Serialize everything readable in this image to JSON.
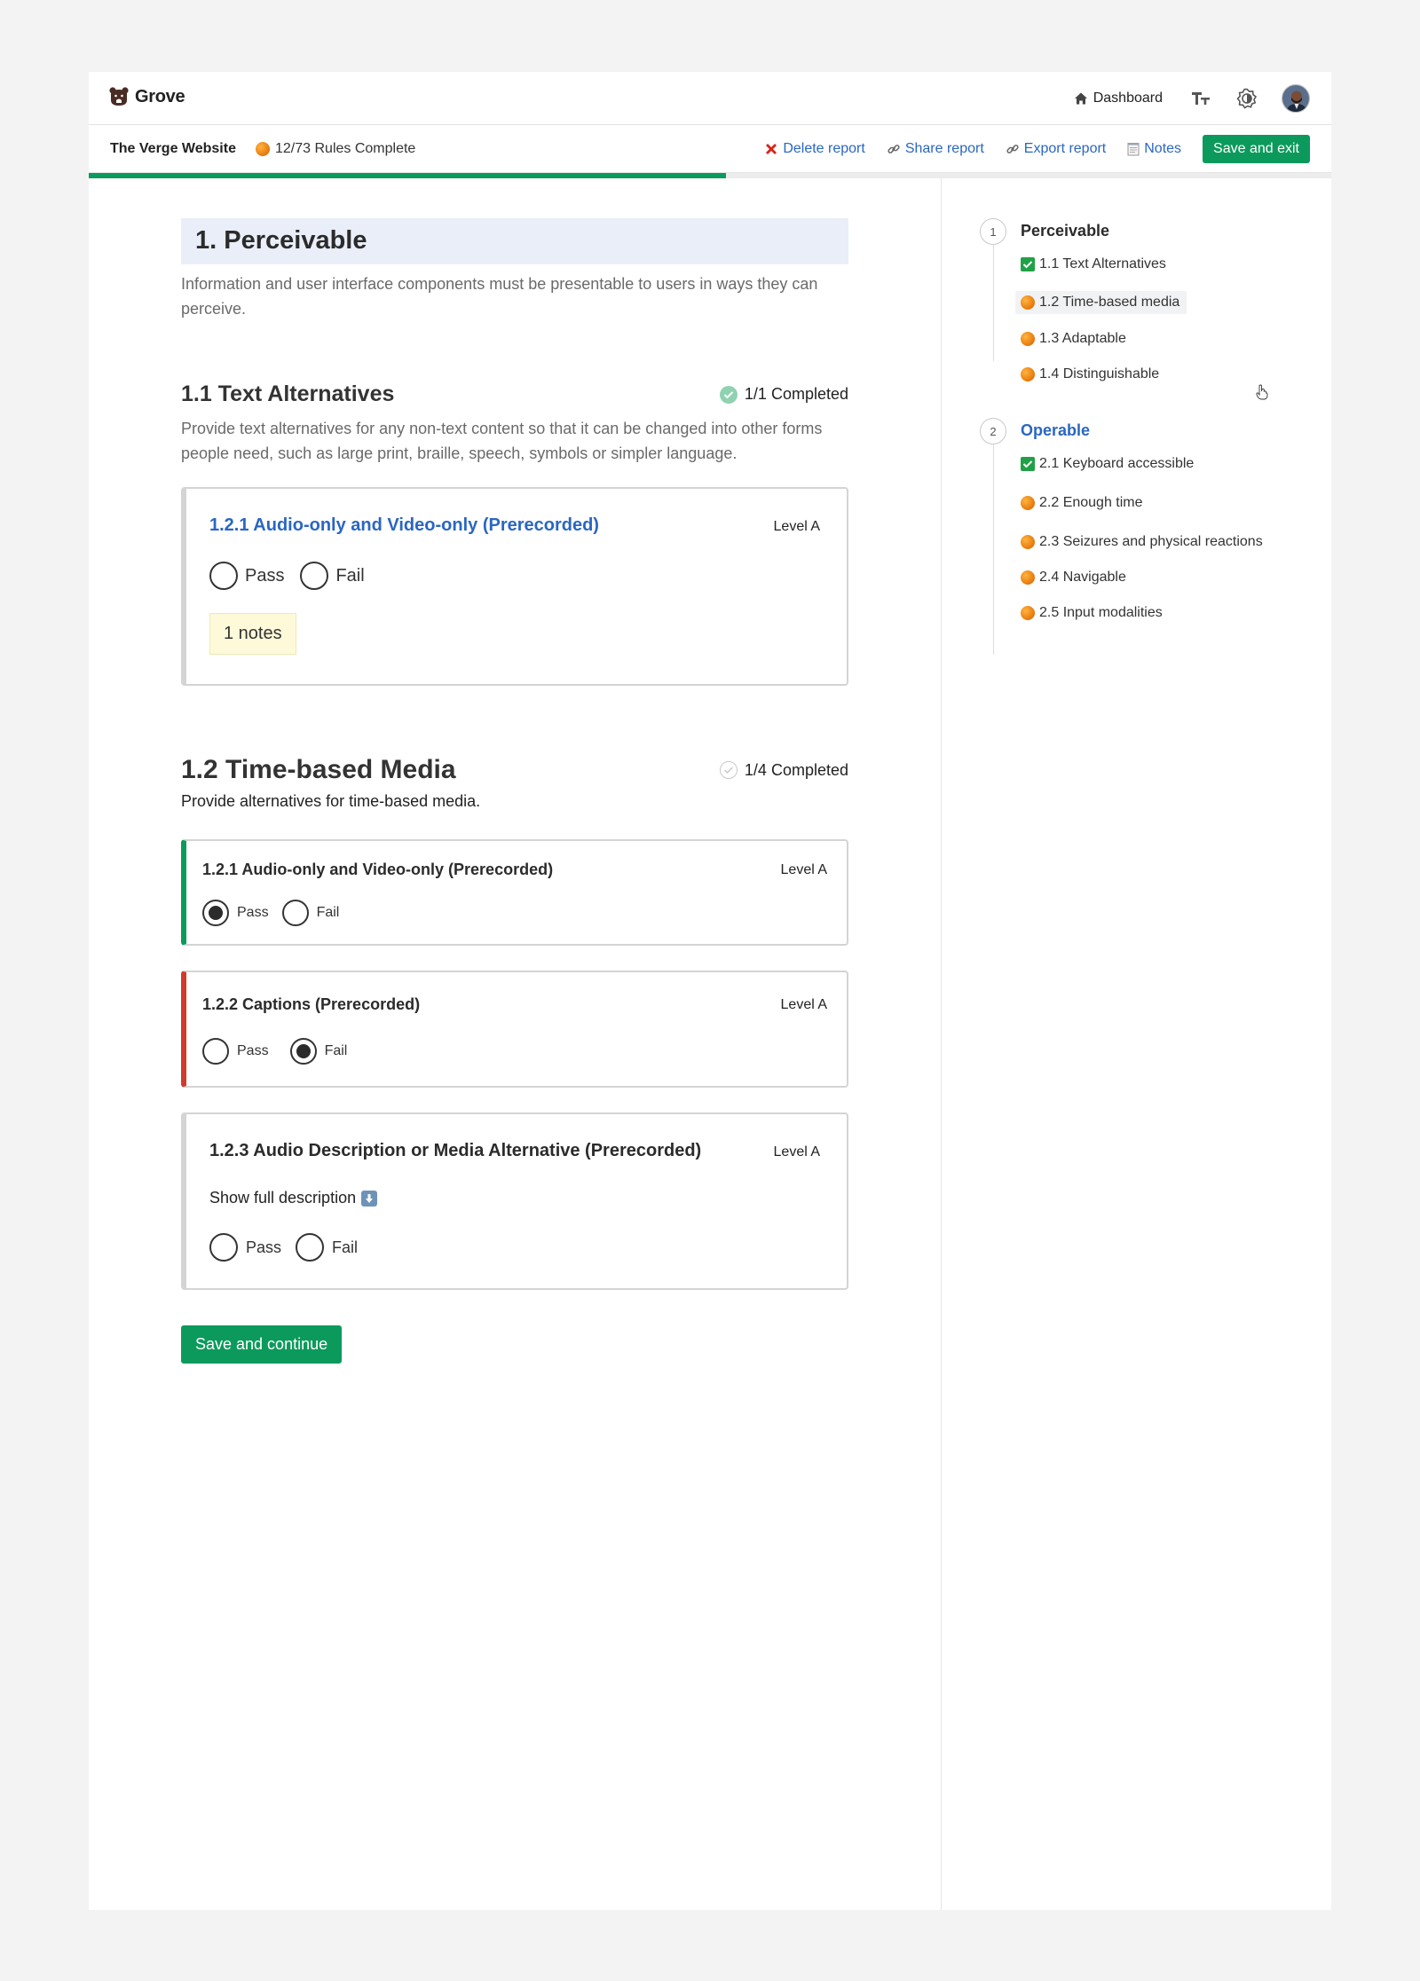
{
  "app": {
    "name": "Grove"
  },
  "header": {
    "dashboard_label": "Dashboard",
    "icons": [
      "text-size-icon",
      "theme-icon",
      "avatar"
    ]
  },
  "report": {
    "title": "The Verge Website",
    "rules_status": "12/73 Rules Complete",
    "progress": 0.513,
    "actions": {
      "delete": "Delete report",
      "share": "Share report",
      "export": "Export report",
      "notes": "Notes",
      "save_exit": "Save and exit"
    }
  },
  "main": {
    "heading": "1. Perceivable",
    "description": "Information and user interface components must be presentable to users in ways they can perceive.",
    "sections": [
      {
        "title": "1.1 Text Alternatives",
        "completed": "1/1 Completed",
        "description": "Provide text alternatives for any non-text content so that it can be changed into other forms people need, such as large print, braille, speech, symbols or simpler language.",
        "cards": [
          {
            "title": "1.2.1 Audio-only and Video-only (Prerecorded)",
            "level": "Level A",
            "pass": "Pass",
            "fail": "Fail",
            "notes": "1 notes"
          }
        ]
      },
      {
        "title": "1.2 Time-based Media",
        "completed": "1/4 Completed",
        "description": "Provide alternatives for time-based media.",
        "cards": [
          {
            "title": "1.2.1 Audio-only and Video-only (Prerecorded)",
            "level": "Level A",
            "pass": "Pass",
            "fail": "Fail",
            "state": "pass"
          },
          {
            "title": "1.2.2 Captions (Prerecorded)",
            "level": "Level A",
            "pass": "Pass",
            "fail": "Fail",
            "state": "fail"
          },
          {
            "title": "1.2.3 Audio Description or Media Alternative (Prerecorded)",
            "level": "Level A",
            "show_description": "Show full description",
            "pass": "Pass",
            "fail": "Fail",
            "state": "none"
          }
        ]
      }
    ],
    "save_continue": "Save and continue"
  },
  "sidebar": {
    "groups": [
      {
        "number": "1",
        "label": "Perceivable",
        "items": [
          {
            "label": "1.1 Text Alternatives",
            "status": "complete"
          },
          {
            "label": "1.2 Time-based media",
            "status": "in-progress"
          },
          {
            "label": "1.3 Adaptable",
            "status": "in-progress"
          },
          {
            "label": "1.4 Distinguishable",
            "status": "in-progress"
          }
        ]
      },
      {
        "number": "2",
        "label": "Operable",
        "items": [
          {
            "label": "2.1 Keyboard accessible",
            "status": "complete"
          },
          {
            "label": "2.2 Enough time",
            "status": "in-progress"
          },
          {
            "label": "2.3 Seizures and physical reactions",
            "status": "in-progress"
          },
          {
            "label": "2.4 Navigable",
            "status": "in-progress"
          },
          {
            "label": "2.5 Input modalities",
            "status": "in-progress"
          }
        ]
      }
    ]
  },
  "colors": {
    "accent_green": "#0c9a5c",
    "link_blue": "#2a66c2",
    "fail_red": "#cf3b2c",
    "in_progress_orange": "#e6770b",
    "heading_bg": "#e9eef9"
  }
}
